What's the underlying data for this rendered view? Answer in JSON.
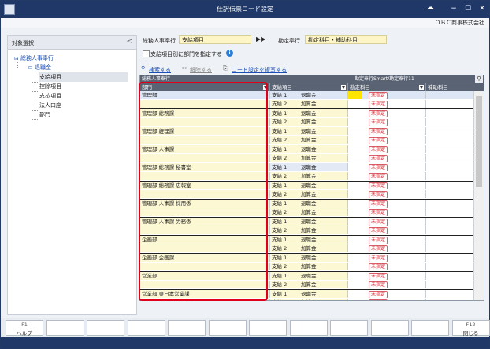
{
  "window": {
    "title": "仕訳伝票コード設定",
    "company": "ＯＢＣ商事株式会社",
    "controls": [
      "−",
      "☐",
      "✕"
    ]
  },
  "left_panel": {
    "header": "対象選択",
    "collapse_glyph": "<",
    "tree": {
      "root": "総務人事奉行",
      "child": "退職金",
      "items": [
        "支給項目",
        "控除項目",
        "支払項目",
        "法人口座",
        "部門"
      ]
    }
  },
  "form": {
    "source_label": "総務人事奉行",
    "source_value": "支給項目",
    "arrow": "▶▶",
    "target_label": "勘定奉行",
    "target_value": "勘定科目・補助科目",
    "checkbox_label": "支給項目別に部門を指定する",
    "checkbox_checked": false
  },
  "actions": {
    "search": "検索する",
    "unlink": "解除する",
    "copy": "コード設定を複写する"
  },
  "grid": {
    "group_left": "総務人事奉行",
    "group_right": "勘定奉行Smart/勘定奉行11",
    "columns": [
      "部門",
      "支給項目",
      "勘定科目",
      "補助科目"
    ],
    "badge": "未指定",
    "rows": [
      {
        "dept": "管理部",
        "items": [
          [
            "支給 1",
            "退職金"
          ],
          [
            "支給 2",
            "加算金"
          ]
        ]
      },
      {
        "dept": "管理部 総務課",
        "items": [
          [
            "支給 1",
            "退職金"
          ],
          [
            "支給 2",
            "加算金"
          ]
        ]
      },
      {
        "dept": "管理部 経理課",
        "items": [
          [
            "支給 1",
            "退職金"
          ],
          [
            "支給 2",
            "加算金"
          ]
        ]
      },
      {
        "dept": "管理部 人事課",
        "items": [
          [
            "支給 1",
            "退職金"
          ],
          [
            "支給 2",
            "加算金"
          ]
        ]
      },
      {
        "dept": "管理部 総務課 秘書室",
        "items": [
          [
            "支給 1",
            "退職金"
          ],
          [
            "支給 2",
            "加算金"
          ]
        ]
      },
      {
        "dept": "管理部 総務課 広報室",
        "items": [
          [
            "支給 1",
            "退職金"
          ],
          [
            "支給 2",
            "加算金"
          ]
        ]
      },
      {
        "dept": "管理部 人事課 採用係",
        "items": [
          [
            "支給 1",
            "退職金"
          ],
          [
            "支給 2",
            "加算金"
          ]
        ]
      },
      {
        "dept": "管理部 人事課 労務係",
        "items": [
          [
            "支給 1",
            "退職金"
          ],
          [
            "支給 2",
            "加算金"
          ]
        ]
      },
      {
        "dept": "企画部",
        "items": [
          [
            "支給 1",
            "退職金"
          ],
          [
            "支給 2",
            "加算金"
          ]
        ]
      },
      {
        "dept": "企画部 企画課",
        "items": [
          [
            "支給 1",
            "退職金"
          ],
          [
            "支給 2",
            "加算金"
          ]
        ]
      },
      {
        "dept": "営業部",
        "items": [
          [
            "支給 1",
            "退職金"
          ],
          [
            "支給 2",
            "加算金"
          ]
        ]
      },
      {
        "dept": "営業部 東日本営業課",
        "items": [
          [
            "支給 1",
            "退職金"
          ],
          [
            "支給 2",
            "加算金"
          ]
        ]
      }
    ]
  },
  "function_keys": [
    {
      "key": "F1",
      "label": "ヘルプ"
    },
    {
      "key": "",
      "label": ""
    },
    {
      "key": "",
      "label": ""
    },
    {
      "key": "",
      "label": ""
    },
    {
      "key": "",
      "label": ""
    },
    {
      "key": "",
      "label": ""
    },
    {
      "key": "",
      "label": ""
    },
    {
      "key": "",
      "label": ""
    },
    {
      "key": "",
      "label": ""
    },
    {
      "key": "",
      "label": ""
    },
    {
      "key": "",
      "label": ""
    },
    {
      "key": "F12",
      "label": "閉じる"
    }
  ]
}
